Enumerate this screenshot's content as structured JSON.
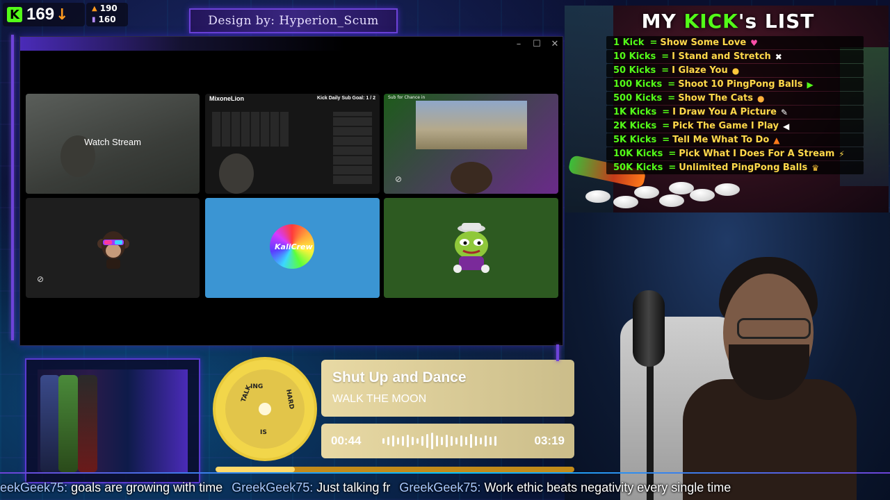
{
  "top_stats": {
    "kick_count": "169",
    "stat_a": "190",
    "stat_b": "160"
  },
  "design_banner": "Design by: Hyperion_Scum",
  "window": {
    "tiles": [
      {
        "label": "Watch Stream"
      },
      {
        "streamer_name": "MixoneLion",
        "goal_text": "Kick Daily Sub Goal: 1 / 2"
      },
      {
        "overlay_text": "Sub for Chance in"
      },
      {},
      {
        "logo_text": "KaliCrew"
      },
      {}
    ]
  },
  "kick_list": {
    "title_prefix": "MY ",
    "title_kick": "KICK",
    "title_suffix": "'s LIST",
    "items": [
      {
        "amount": "1 Kick",
        "reward": "Show Some Love",
        "icon": "heart-icon"
      },
      {
        "amount": "10 Kicks",
        "reward": "I Stand and Stretch",
        "icon": "stretch-icon"
      },
      {
        "amount": "50 Kicks",
        "reward": "I Glaze You",
        "icon": "glaze-emoji-icon"
      },
      {
        "amount": "100 Kicks",
        "reward": "Shoot 10 PingPong Balls",
        "icon": "blaster-icon"
      },
      {
        "amount": "500 Kicks",
        "reward": "Show The Cats",
        "icon": "cat-icon"
      },
      {
        "amount": "1K Kicks",
        "reward": "I Draw You A Picture",
        "icon": "pencil-icon"
      },
      {
        "amount": "2K Kicks",
        "reward": "Pick The Game I Play",
        "icon": "megaphone-icon"
      },
      {
        "amount": "5K Kicks",
        "reward": "Tell Me What To Do",
        "icon": "fire-icon"
      },
      {
        "amount": "10K Kicks",
        "reward": "Pick What I Does For A Stream",
        "icon": "lightning-icon"
      },
      {
        "amount": "50K Kicks",
        "reward": "Unlimited PingPong Balls",
        "icon": "trophy-icon"
      }
    ]
  },
  "music": {
    "title": "Shut Up and Dance",
    "artist": "WALK THE MOON",
    "current_time": "00:44",
    "total_time": "03:19",
    "progress": 0.22,
    "album_text": [
      "TALK",
      "ING",
      "IS",
      "HARD"
    ]
  },
  "ticker": [
    {
      "user": "eekGeek75:",
      "msg": "goals are growing with time"
    },
    {
      "user": "GreekGeek75:",
      "msg": "Just talking fr"
    },
    {
      "user": "GreekGeek75:",
      "msg": "Work ethic beats negativity every single time"
    }
  ],
  "colors": {
    "kick_green": "#53fc18",
    "accent_purple": "#6e43d8",
    "player_gold": "#e8d9a4"
  }
}
